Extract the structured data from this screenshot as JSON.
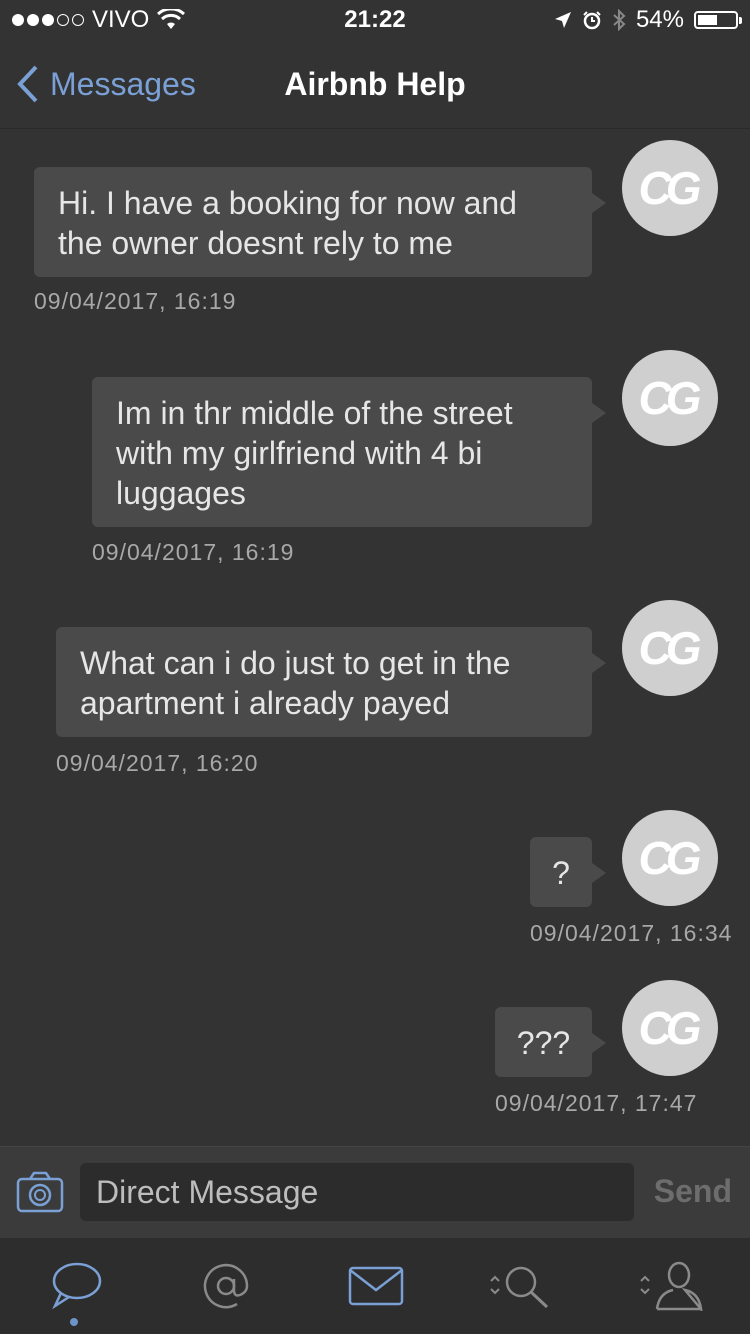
{
  "status_bar": {
    "carrier": "VIVO",
    "time": "21:22",
    "battery": "54%",
    "battery_level": 0.54,
    "icons": [
      "signal-dots",
      "wifi-icon",
      "location-icon",
      "alarm-icon",
      "bluetooth-icon",
      "battery-icon"
    ]
  },
  "nav": {
    "back_label": "Messages",
    "title": "Airbnb Help"
  },
  "avatar_initials": "CG",
  "messages": [
    {
      "text": "Hi. I have a booking for now and the owner doesnt rely to me",
      "timestamp": "09/04/2017, 16:19"
    },
    {
      "text": "Im in thr middle of the street with my girlfriend with 4 bi luggages",
      "timestamp": "09/04/2017, 16:19"
    },
    {
      "text": "What can i do just to get in the apartment i already payed",
      "timestamp": "09/04/2017, 16:20"
    },
    {
      "text": "?",
      "timestamp": "09/04/2017, 16:34"
    },
    {
      "text": "???",
      "timestamp": "09/04/2017, 17:47"
    }
  ],
  "compose": {
    "placeholder": "Direct Message",
    "send_label": "Send"
  },
  "tab_bar": {
    "tabs": [
      "chat-bubble-icon",
      "mention-icon",
      "envelope-icon",
      "search-icon",
      "profile-icon"
    ],
    "active_tab": "chat-bubble-icon"
  },
  "colors": {
    "accent": "#7aa0d6",
    "background": "#333333",
    "bubble": "#4a4a4a"
  }
}
